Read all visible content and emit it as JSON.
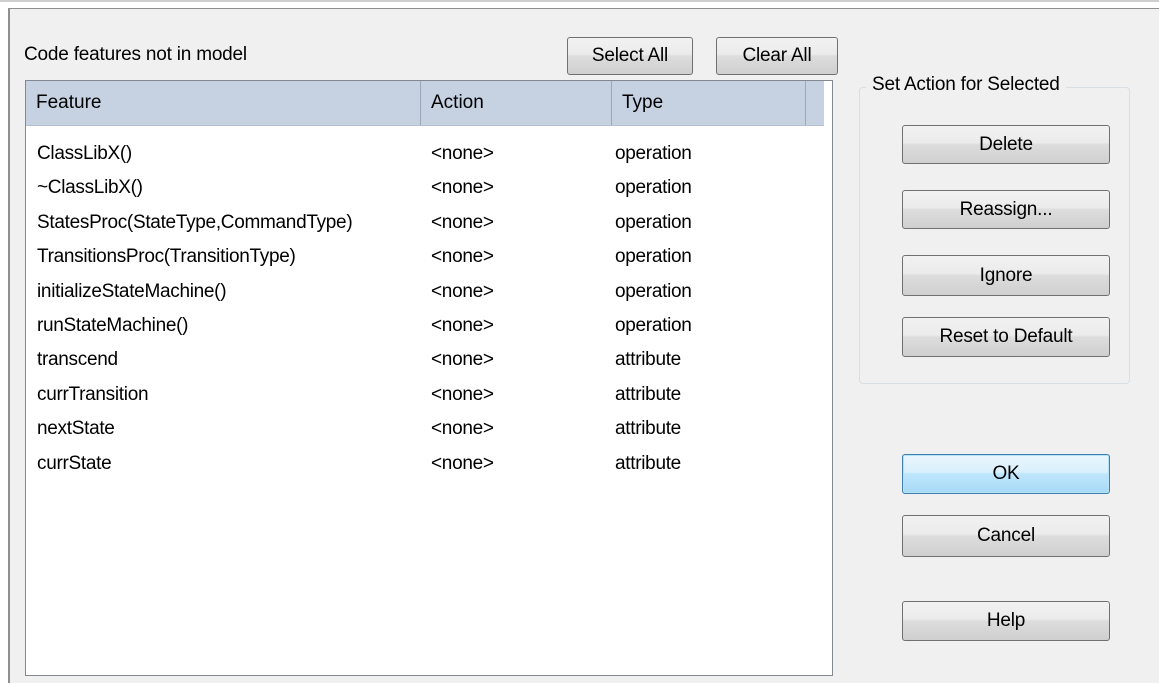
{
  "dialog": {
    "features_label": "Code features not in model",
    "select_all_label": "Select All",
    "clear_all_label": "Clear All"
  },
  "list": {
    "columns": [
      "Feature",
      "Action",
      "Type"
    ],
    "rows": [
      {
        "feature": "ClassLibX()",
        "action": "<none>",
        "type": "operation"
      },
      {
        "feature": "~ClassLibX()",
        "action": "<none>",
        "type": "operation"
      },
      {
        "feature": "StatesProc(StateType,CommandType)",
        "action": "<none>",
        "type": "operation"
      },
      {
        "feature": "TransitionsProc(TransitionType)",
        "action": "<none>",
        "type": "operation"
      },
      {
        "feature": "initializeStateMachine()",
        "action": "<none>",
        "type": "operation"
      },
      {
        "feature": "runStateMachine()",
        "action": "<none>",
        "type": "operation"
      },
      {
        "feature": "transcend",
        "action": "<none>",
        "type": "attribute"
      },
      {
        "feature": "currTransition",
        "action": "<none>",
        "type": "attribute"
      },
      {
        "feature": "nextState",
        "action": "<none>",
        "type": "attribute"
      },
      {
        "feature": "currState",
        "action": "<none>",
        "type": "attribute"
      }
    ]
  },
  "action_group": {
    "title": "Set Action for Selected",
    "delete_label": "Delete",
    "reassign_label": "Reassign...",
    "ignore_label": "Ignore",
    "reset_label": "Reset to Default"
  },
  "buttons": {
    "ok_label": "OK",
    "cancel_label": "Cancel",
    "help_label": "Help"
  },
  "colors": {
    "header_bg": "#c6d1e2",
    "default_button_border": "#3c7fb1"
  }
}
